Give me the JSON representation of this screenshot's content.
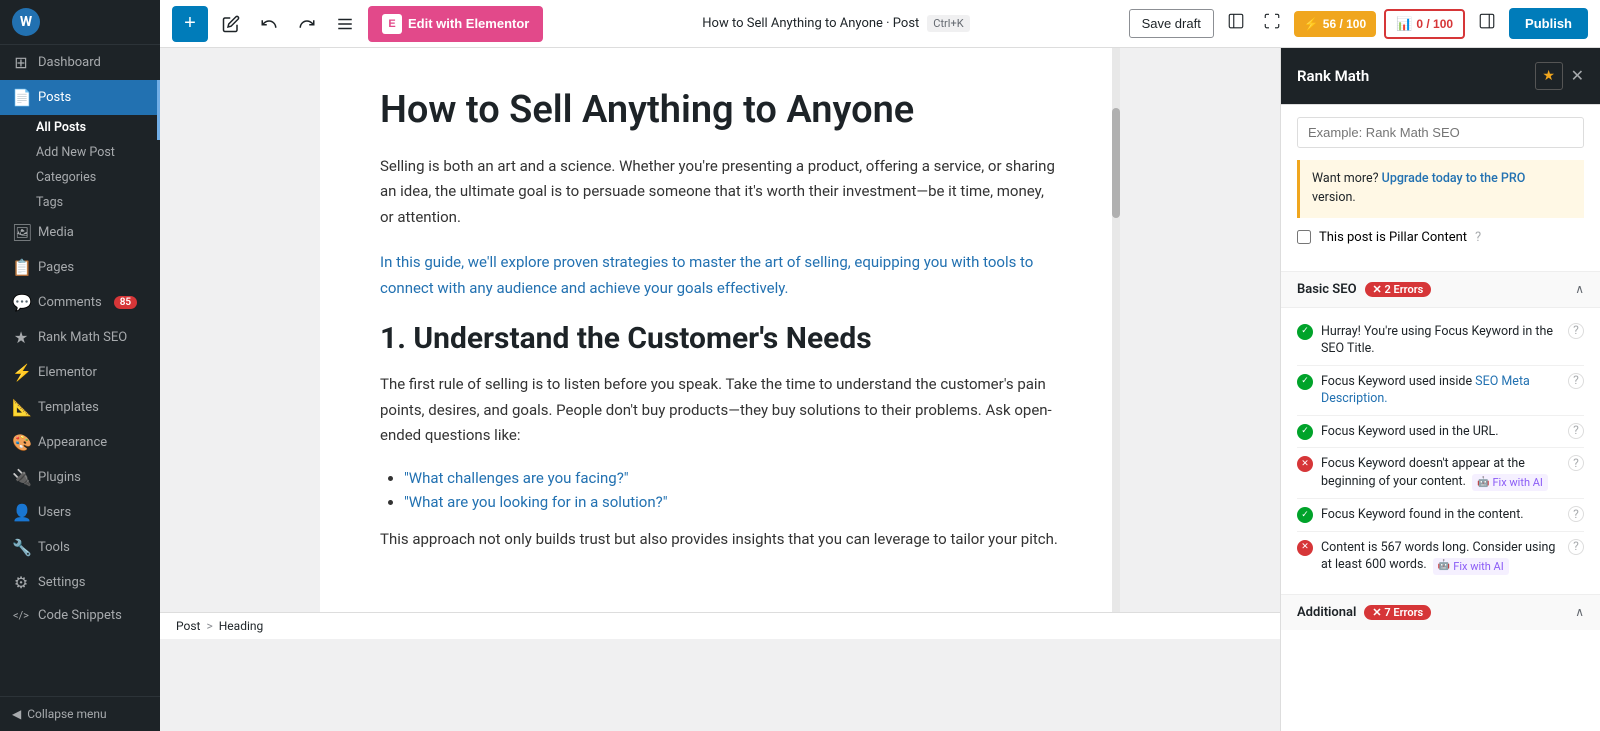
{
  "sidebar": {
    "logo_text": "W",
    "items": [
      {
        "id": "dashboard",
        "label": "Dashboard",
        "icon": "⊞",
        "active": false
      },
      {
        "id": "posts",
        "label": "Posts",
        "icon": "📄",
        "active": true
      },
      {
        "id": "media",
        "label": "Media",
        "icon": "🖼",
        "active": false
      },
      {
        "id": "pages",
        "label": "Pages",
        "icon": "📋",
        "active": false
      },
      {
        "id": "comments",
        "label": "Comments",
        "icon": "💬",
        "active": false,
        "badge": "85"
      },
      {
        "id": "rank-math",
        "label": "Rank Math SEO",
        "icon": "★",
        "active": false
      },
      {
        "id": "elementor",
        "label": "Elementor",
        "icon": "⚡",
        "active": false
      },
      {
        "id": "templates",
        "label": "Templates",
        "icon": "📐",
        "active": false
      },
      {
        "id": "appearance",
        "label": "Appearance",
        "icon": "🎨",
        "active": false
      },
      {
        "id": "plugins",
        "label": "Plugins",
        "icon": "🔌",
        "active": false
      },
      {
        "id": "users",
        "label": "Users",
        "icon": "👤",
        "active": false
      },
      {
        "id": "tools",
        "label": "Tools",
        "icon": "🔧",
        "active": false
      },
      {
        "id": "settings",
        "label": "Settings",
        "icon": "⚙",
        "active": false
      },
      {
        "id": "code-snippets",
        "label": "Code Snippets",
        "icon": "< >",
        "active": false
      }
    ],
    "sub_items": [
      {
        "id": "all-posts",
        "label": "All Posts",
        "active": true
      },
      {
        "id": "add-new",
        "label": "Add New Post",
        "active": false
      },
      {
        "id": "categories",
        "label": "Categories",
        "active": false
      },
      {
        "id": "tags",
        "label": "Tags",
        "active": false
      }
    ],
    "collapse_label": "Collapse menu"
  },
  "toolbar": {
    "add_label": "+",
    "edit_elementor_label": "Edit with Elementor",
    "edit_elementor_icon": "E",
    "post_title": "How to Sell Anything to Anyone · Post",
    "shortcut": "Ctrl+K",
    "save_draft_label": "Save draft",
    "seo_score": "56 / 100",
    "content_score": "0 / 100",
    "publish_label": "Publish"
  },
  "editor": {
    "post_heading": "How to Sell Anything to Anyone",
    "paragraph1": "Selling is both an art and a science. Whether you're presenting a product, offering a service, or sharing an idea, the ultimate goal is to persuade someone that it's worth their investment—be it time, money, or attention.",
    "paragraph2": "In this guide, we'll explore proven strategies to master the art of selling, equipping you with tools to connect with any audience and achieve your goals effectively.",
    "section1_heading": "1. Understand the Customer's Needs",
    "section1_para": "The first rule of selling is to listen before you speak. Take the time to understand the customer's pain points, desires, and goals. People don't buy products—they buy solutions to their problems. Ask open-ended questions like:",
    "bullet1": "\"What challenges are you facing?\"",
    "bullet2": "\"What are you looking for in a solution?\"",
    "section1_close": "This approach not only builds trust but also provides insights that you can leverage to tailor your pitch.",
    "breadcrumb_post": "Post",
    "breadcrumb_sep": ">",
    "breadcrumb_heading": "Heading"
  },
  "rank_math": {
    "title": "Rank Math",
    "star_icon": "★",
    "close_icon": "✕",
    "input_placeholder": "Example: Rank Math SEO",
    "upgrade_text": "Want more?",
    "upgrade_link": "Upgrade today to the PRO",
    "upgrade_text2": "version.",
    "pillar_label": "This post is Pillar Content",
    "basic_seo_label": "Basic SEO",
    "basic_seo_errors": "✕ 2 Errors",
    "toggle_icon": "∧",
    "checks": [
      {
        "type": "green",
        "text": "Hurray! You're using Focus Keyword in the SEO Title.",
        "has_link": false,
        "link_text": ""
      },
      {
        "type": "green",
        "text": "Focus Keyword used inside SEO Meta Description.",
        "has_link": false
      },
      {
        "type": "green",
        "text": "Focus Keyword used in the URL.",
        "has_link": false
      },
      {
        "type": "red",
        "text": "Focus Keyword doesn't appear at the beginning of your content.",
        "has_fix_ai": true,
        "fix_text": "Fix with AI"
      },
      {
        "type": "green",
        "text": "Focus Keyword found in the content.",
        "has_fix_ai": false
      },
      {
        "type": "red",
        "text": "Content is 567 words long. Consider using at least 600 words.",
        "has_fix_ai": true,
        "fix_text": "Fix with AI"
      }
    ],
    "additional_label": "Additional",
    "additional_errors": "✕ 7 Errors",
    "additional_toggle": "∧"
  }
}
